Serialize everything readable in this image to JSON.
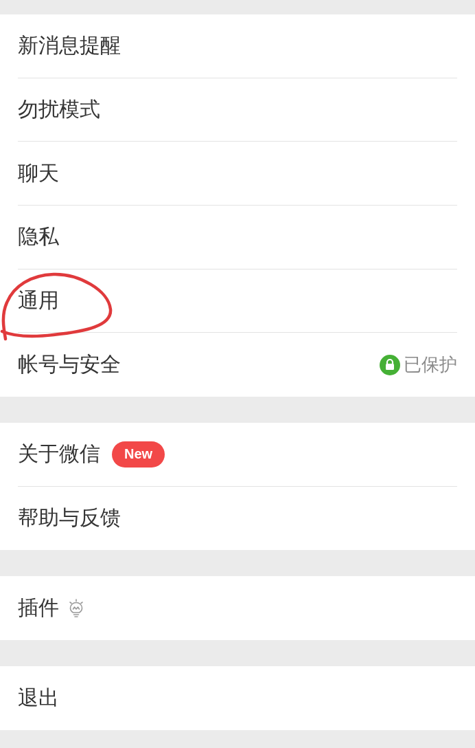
{
  "groups": [
    {
      "items": [
        {
          "label": "新消息提醒",
          "kind": "plain",
          "circled": false
        },
        {
          "label": "勿扰模式",
          "kind": "plain",
          "circled": false
        },
        {
          "label": "聊天",
          "kind": "plain",
          "circled": false
        },
        {
          "label": "隐私",
          "kind": "plain",
          "circled": false
        },
        {
          "label": "通用",
          "kind": "plain",
          "circled": true
        },
        {
          "label": "帐号与安全",
          "kind": "status",
          "status": "已保护",
          "circled": false
        }
      ]
    },
    {
      "items": [
        {
          "label": "关于微信",
          "kind": "badge",
          "badge": "New",
          "circled": false
        },
        {
          "label": "帮助与反馈",
          "kind": "plain",
          "circled": false
        }
      ]
    },
    {
      "items": [
        {
          "label": "插件",
          "kind": "icon",
          "circled": false
        }
      ]
    },
    {
      "items": [
        {
          "label": "退出",
          "kind": "plain",
          "circled": false
        }
      ]
    }
  ]
}
